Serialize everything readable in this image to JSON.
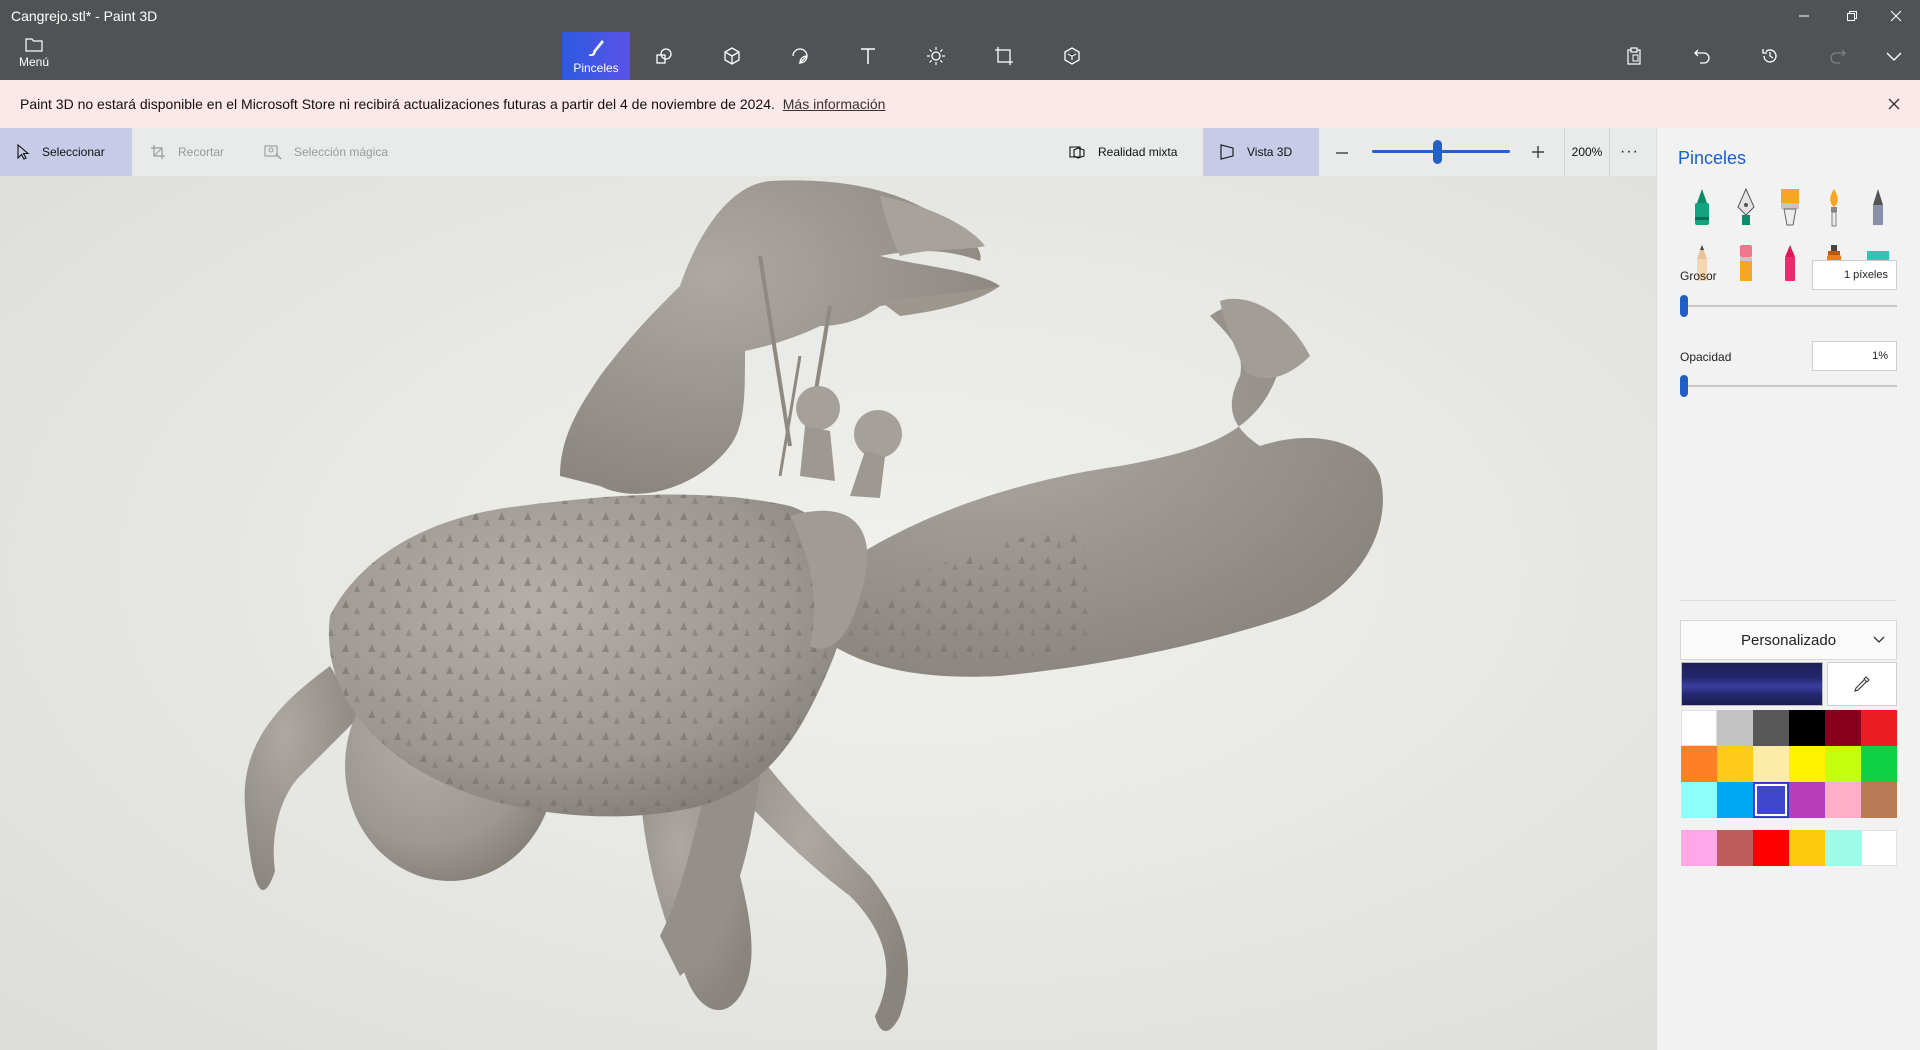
{
  "window": {
    "title": "Cangrejo.stl* - Paint 3D",
    "controls": [
      "minimize",
      "restore",
      "close"
    ]
  },
  "toolbar": {
    "menu_label": "Menú",
    "active_tool_label": "Pinceles",
    "tools": [
      "brushes-icon",
      "2d-shapes-icon",
      "3d-shapes-icon",
      "stickers-icon",
      "text-icon",
      "effects-icon",
      "canvas-icon",
      "3d-library-icon"
    ],
    "right_tools": [
      "paste-icon",
      "undo-icon",
      "history-icon",
      "redo-icon",
      "expand-icon"
    ]
  },
  "notice": {
    "text": "Paint 3D no estará disponible en el Microsoft Store ni recibirá actualizaciones futuras a partir del 4 de noviembre de 2024.",
    "link": "Más información"
  },
  "subbar": {
    "select": "Seleccionar",
    "crop": "Recortar",
    "magic_select": "Selección mágica",
    "mixed_reality": "Realidad mixta",
    "view3d": "Vista 3D",
    "zoom": "200%",
    "zoom_fraction": 0.47
  },
  "panel": {
    "title": "Pinceles",
    "brushes": [
      "marker-icon",
      "calligraphy-pen-icon",
      "oil-brush-icon",
      "watercolor-icon",
      "pixel-pen-icon",
      "pencil-icon",
      "eraser-icon",
      "crayon-icon",
      "spray-can-icon",
      "fill-icon"
    ],
    "thickness_label": "Grosor",
    "thickness_value": "1 píxeles",
    "thickness_fraction": 0.0,
    "opacity_label": "Opacidad",
    "opacity_value": "1%",
    "opacity_fraction": 0.0,
    "finish": "Personalizado",
    "current_color": "#23286e",
    "palette": [
      "#ffffff",
      "#c3c3c3",
      "#585858",
      "#000000",
      "#88001b",
      "#ec1c24",
      "#ff7f27",
      "#ffca18",
      "#fdeca6",
      "#fff200",
      "#c4ff0e",
      "#0ed145",
      "#8cfffb",
      "#00a8f3",
      "#3f48cc",
      "#b83dba",
      "#ffaec8",
      "#b97a56"
    ],
    "active_swatch": 14,
    "custom_colors": [
      "#ffa7e8",
      "#be5b5b",
      "#ff0000",
      "#ffc90e",
      "#9dfce8",
      "#ffffff"
    ]
  }
}
